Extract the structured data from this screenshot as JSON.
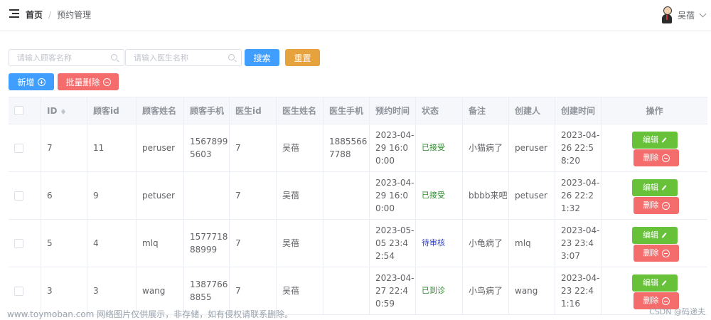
{
  "header": {
    "breadcrumb_home": "首页",
    "breadcrumb_sep": "/",
    "breadcrumb_current": "预约管理",
    "user_name": "吴蓓"
  },
  "search": {
    "customer_placeholder": "请输入顾客名称",
    "doctor_placeholder": "请输入医生名称",
    "search_label": "搜索",
    "reset_label": "重置"
  },
  "actions": {
    "add_label": "新增",
    "batch_delete_label": "批量删除"
  },
  "table": {
    "columns": [
      "ID",
      "顾客id",
      "顾客姓名",
      "顾客手机",
      "医生id",
      "医生姓名",
      "医生手机",
      "预约时间",
      "状态",
      "备注",
      "创建人",
      "创建时间",
      "操作"
    ],
    "edit_label": "编辑",
    "delete_label": "删除",
    "rows": [
      {
        "id": "7",
        "customer_id": "11",
        "customer_name": "peruser",
        "customer_phone": "15678995603",
        "doctor_id": "7",
        "doctor_name": "吴蓓",
        "doctor_phone": "18855667788",
        "appt_time": "2023-04-29 16:00:00",
        "status": "已接受",
        "remark": "小猫病了",
        "creator": "peruser",
        "created": "2023-04-26 22:58:20"
      },
      {
        "id": "6",
        "customer_id": "9",
        "customer_name": "petuser",
        "customer_phone": "",
        "doctor_id": "7",
        "doctor_name": "吴蓓",
        "doctor_phone": "",
        "appt_time": "2023-04-29 16:00:00",
        "status": "已接受",
        "remark": "bbbb来吧",
        "creator": "petuser",
        "created": "2023-04-26 22:21:32"
      },
      {
        "id": "5",
        "customer_id": "4",
        "customer_name": "mlq",
        "customer_phone": "1577718 88999",
        "doctor_id": "7",
        "doctor_name": "吴蓓",
        "doctor_phone": "",
        "appt_time": "2023-05-05 23:42:54",
        "status": "待审核",
        "remark": "小龟病了",
        "creator": "mlq",
        "created": "2023-04-23 23:43:07"
      },
      {
        "id": "3",
        "customer_id": "3",
        "customer_name": "wang",
        "customer_phone": "13877668855",
        "doctor_id": "7",
        "doctor_name": "吴蓓",
        "doctor_phone": "",
        "appt_time": "2023-04-27 22:40:59",
        "status": "已到诊",
        "remark": "小鸟病了",
        "creator": "wang",
        "created": "2023-04-23 22:41:16"
      }
    ]
  },
  "watermark": "www.toymoban.com 网络图片仅供展示，非存储，如有侵权请联系删除。",
  "credit": "CSDN @码递夫",
  "colors": {
    "primary": "#409eff",
    "warning": "#e6a23c",
    "danger": "#f56c6c",
    "success": "#67c23a"
  }
}
